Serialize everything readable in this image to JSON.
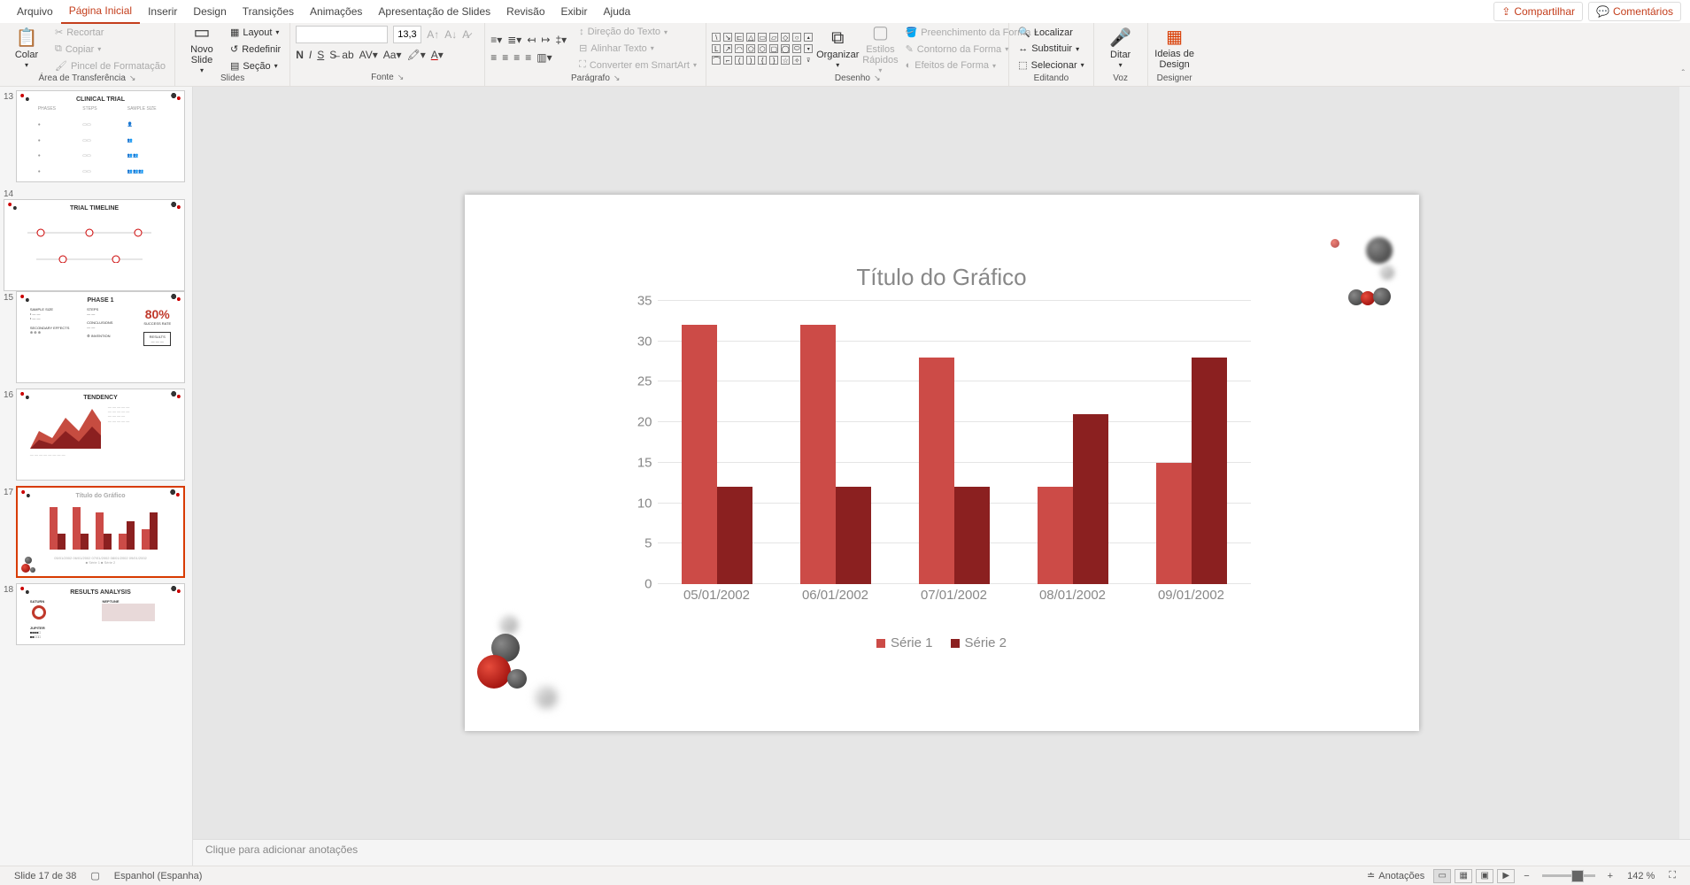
{
  "menubar": {
    "items": [
      "Arquivo",
      "Página Inicial",
      "Inserir",
      "Design",
      "Transições",
      "Animações",
      "Apresentação de Slides",
      "Revisão",
      "Exibir",
      "Ajuda"
    ],
    "active_index": 1,
    "share": "Compartilhar",
    "comments": "Comentários"
  },
  "ribbon": {
    "clipboard": {
      "label": "Área de Transferência",
      "paste": "Colar",
      "cut": "Recortar",
      "copy": "Copiar",
      "format_painter": "Pincel de Formatação"
    },
    "slides": {
      "label": "Slides",
      "new_slide": "Novo Slide",
      "layout": "Layout",
      "reset": "Redefinir",
      "section": "Seção"
    },
    "font": {
      "label": "Fonte",
      "name_placeholder": "",
      "size": "13,3"
    },
    "paragraph": {
      "label": "Parágrafo",
      "text_direction": "Direção do Texto",
      "align_text": "Alinhar Texto",
      "smartart": "Converter em SmartArt"
    },
    "drawing": {
      "label": "Desenho",
      "arrange": "Organizar",
      "quick_styles": "Estilos Rápidos",
      "shape_fill": "Preenchimento da Forma",
      "shape_outline": "Contorno da Forma",
      "shape_effects": "Efeitos de Forma"
    },
    "editing": {
      "label": "Editando",
      "find": "Localizar",
      "replace": "Substituir",
      "select": "Selecionar"
    },
    "voice": {
      "label": "Voz",
      "dictate": "Ditar"
    },
    "designer": {
      "label": "Designer",
      "design_ideas": "Ideias de Design"
    }
  },
  "thumbnails": {
    "visible": [
      {
        "num": 13,
        "title": "CLINICAL TRIAL"
      },
      {
        "num": 14,
        "title": "TRIAL TIMELINE"
      },
      {
        "num": 15,
        "title": "PHASE 1",
        "percent": "80%"
      },
      {
        "num": 16,
        "title": "TENDENCY"
      },
      {
        "num": 17,
        "title": "Título do Gráfico",
        "selected": true
      },
      {
        "num": 18,
        "title": "RESULTS ANALYSIS"
      }
    ]
  },
  "chart_data": {
    "type": "bar",
    "title": "Título do Gráfico",
    "categories": [
      "05/01/2002",
      "06/01/2002",
      "07/01/2002",
      "08/01/2002",
      "09/01/2002"
    ],
    "series": [
      {
        "name": "Série 1",
        "values": [
          32,
          32,
          28,
          12,
          15
        ],
        "color": "#cc4b47"
      },
      {
        "name": "Série 2",
        "values": [
          12,
          12,
          12,
          21,
          28
        ],
        "color": "#8b2020"
      }
    ],
    "y_ticks": [
      0,
      5,
      10,
      15,
      20,
      25,
      30,
      35
    ],
    "ylim": [
      0,
      35
    ],
    "xlabel": "",
    "ylabel": ""
  },
  "notes": {
    "placeholder": "Clique para adicionar anotações"
  },
  "statusbar": {
    "slide_indicator": "Slide 17 de 38",
    "language": "Espanhol (Espanha)",
    "notes_btn": "Anotações",
    "zoom": "142 %"
  }
}
